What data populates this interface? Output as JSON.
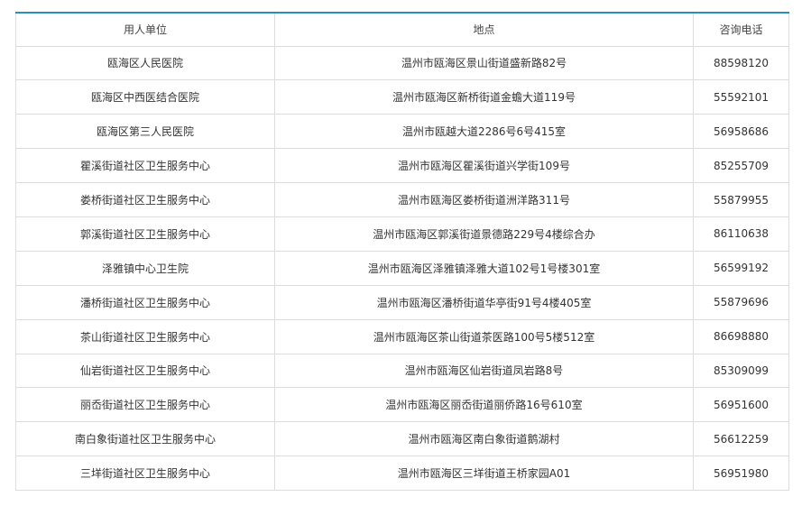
{
  "table": {
    "headers": [
      "用人单位",
      "地点",
      "咨询电话"
    ],
    "rows": [
      [
        "瓯海区人民医院",
        "温州市瓯海区景山街道盛新路82号",
        "88598120"
      ],
      [
        "瓯海区中西医结合医院",
        "温州市瓯海区新桥街道金蟾大道119号",
        "55592101"
      ],
      [
        "瓯海区第三人民医院",
        "温州市瓯越大道2286号6号415室",
        "56958686"
      ],
      [
        "瞿溪街道社区卫生服务中心",
        "温州市瓯海区瞿溪街道兴学街109号",
        "85255709"
      ],
      [
        "娄桥街道社区卫生服务中心",
        "温州市瓯海区娄桥街道洲洋路311号",
        "55879955"
      ],
      [
        "郭溪街道社区卫生服务中心",
        "温州市瓯海区郭溪街道景德路229号4楼综合办",
        "86110638"
      ],
      [
        "泽雅镇中心卫生院",
        "温州市瓯海区泽雅镇泽雅大道102号1号楼301室",
        "56599192"
      ],
      [
        "潘桥街道社区卫生服务中心",
        "温州市瓯海区潘桥街道华亭街91号4楼405室",
        "55879696"
      ],
      [
        "茶山街道社区卫生服务中心",
        "温州市瓯海区茶山街道茶医路100号5楼512室",
        "86698880"
      ],
      [
        "仙岩街道社区卫生服务中心",
        "温州市瓯海区仙岩街道凤岩路8号",
        "85309099"
      ],
      [
        "丽岙街道社区卫生服务中心",
        "温州市瓯海区丽岙街道丽侨路16号610室",
        "56951600"
      ],
      [
        "南白象街道社区卫生服务中心",
        "温州市瓯海区南白象街道鹅湖村",
        "56612259"
      ],
      [
        "三垟街道社区卫生服务中心",
        "温州市瓯海区三垟街道王桥家园A01",
        "56951980"
      ]
    ]
  }
}
